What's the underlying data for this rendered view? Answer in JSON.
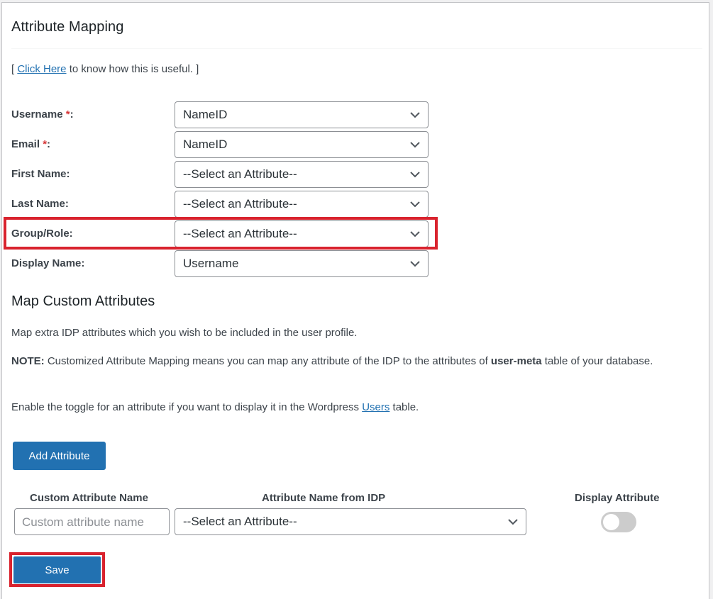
{
  "section": {
    "title": "Attribute Mapping",
    "help_prefix": "[ ",
    "help_link": "Click Here",
    "help_suffix": " to know how this is useful. ]"
  },
  "fields": [
    {
      "label": "Username",
      "required": true,
      "value": "NameID"
    },
    {
      "label": "Email",
      "required": true,
      "value": "NameID"
    },
    {
      "label": "First Name",
      "required": false,
      "value": "--Select an Attribute--"
    },
    {
      "label": "Last Name",
      "required": false,
      "value": "--Select an Attribute--"
    },
    {
      "label": "Group/Role",
      "required": false,
      "value": "--Select an Attribute--",
      "highlighted": true
    },
    {
      "label": "Display Name",
      "required": false,
      "value": "Username"
    }
  ],
  "required_marker": "*",
  "label_suffix": ":",
  "custom": {
    "title": "Map Custom Attributes",
    "description": "Map extra IDP attributes which you wish to be included in the user profile.",
    "note_label": "NOTE:",
    "note_text_1": " Customized Attribute Mapping means you can map any attribute of the IDP to the attributes of ",
    "note_bold": "user-meta",
    "note_text_2": " table of your database.",
    "toggle_text_1": "Enable the toggle for an attribute if you want to display it in the Wordpress ",
    "toggle_link": "Users",
    "toggle_text_2": " table.",
    "add_button": "Add Attribute",
    "columns": [
      "Custom Attribute Name",
      "Attribute Name from IDP",
      "Display Attribute"
    ],
    "row": {
      "name_placeholder": "Custom attribute name",
      "idp_value": "--Select an Attribute--",
      "display_enabled": false
    }
  },
  "save_button": "Save",
  "colors": {
    "primary": "#2271b1",
    "highlight": "#d9232e",
    "required": "#d63638"
  }
}
